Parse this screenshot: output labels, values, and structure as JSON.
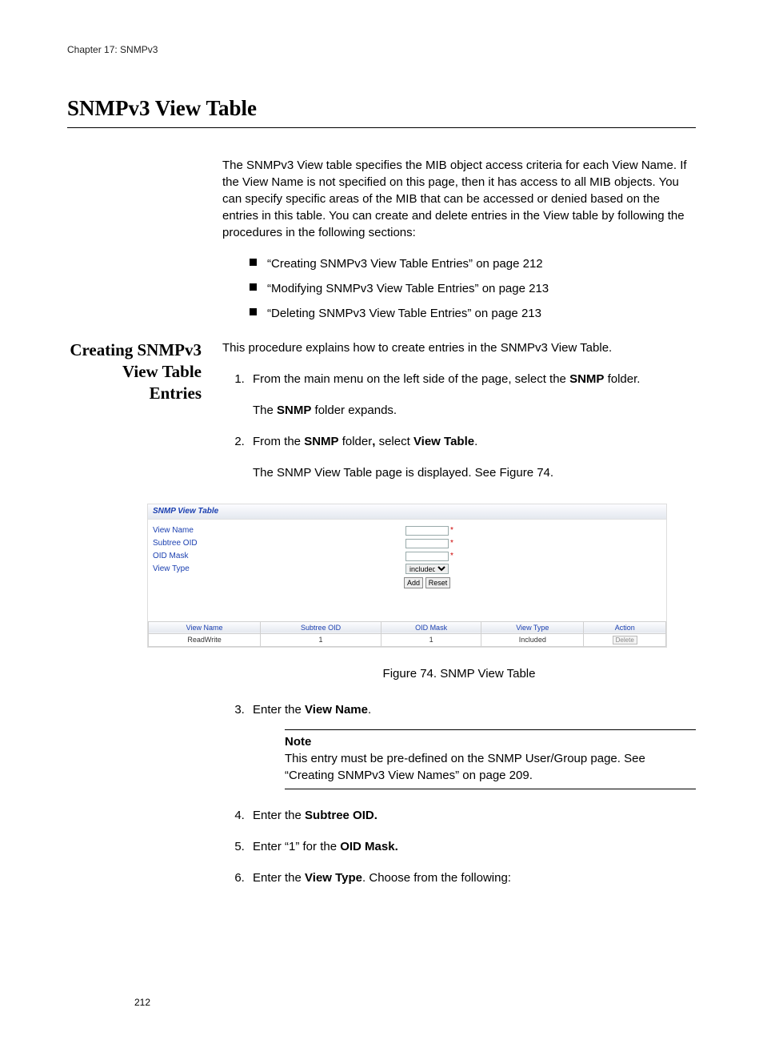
{
  "chapterLine": "Chapter 17: SNMPv3",
  "h1": "SNMPv3 View Table",
  "introPara": "The SNMPv3 View table specifies the MIB object access criteria for each View Name. If the View Name is not specified on this page, then it has access to all MIB objects. You can specify specific areas of the MIB that can be accessed or denied based on the entries in this table. You can create and delete entries in the View table by following the procedures in the following sections:",
  "bullets": [
    "“Creating SNMPv3 View Table Entries” on page 212",
    "“Modifying SNMPv3 View Table Entries” on page 213",
    "“Deleting SNMPv3 View Table Entries” on page 213"
  ],
  "sideHeading": "Creating SNMPv3 View Table Entries",
  "procIntro": "This procedure explains how to create entries in the SNMPv3 View Table.",
  "step1_a": "From the main menu on the left side of the page, select the ",
  "step1_b_bold": "SNMP",
  "step1_c": " folder.",
  "step1_sub_a": "The ",
  "step1_sub_b_bold": "SNMP",
  "step1_sub_c": " folder expands.",
  "step2_a": "From the ",
  "step2_b_bold": "SNMP",
  "step2_c": " folder",
  "step2_c2_bold": ",",
  "step2_d": " select ",
  "step2_e_bold": "View Table",
  "step2_f": ".",
  "step2_sub": "The SNMP View Table page is displayed. See Figure 74.",
  "figCaption": "Figure 74. SNMP View Table",
  "step3_a": "Enter the ",
  "step3_b_bold": "View Name",
  "step3_c": ".",
  "note_label": "Note",
  "note_body": "This entry must be pre-defined on the SNMP User/Group page. See “Creating SNMPv3 View Names” on page 209.",
  "step4_a": "Enter the ",
  "step4_b_bold": "Subtree OID.",
  "step5_a": "Enter “1” for the ",
  "step5_b_bold": "OID Mask.",
  "step6_a": "Enter the ",
  "step6_b_bold": "View Type",
  "step6_c": ". Choose from the following:",
  "pageNumber": "212",
  "snmp": {
    "title": "SNMP View Table",
    "labels": {
      "viewName": "View Name",
      "subtreeOID": "Subtree OID",
      "oidMask": "OID Mask",
      "viewType": "View Type"
    },
    "selectValue": "included",
    "buttons": {
      "add": "Add",
      "reset": "Reset",
      "delete": "Delete"
    },
    "headers": {
      "viewName": "View Name",
      "subtreeOID": "Subtree OID",
      "oidMask": "OID Mask",
      "viewType": "View Type",
      "action": "Action"
    },
    "row": {
      "viewName": "ReadWrite",
      "subtreeOID": "1",
      "oidMask": "1",
      "viewType": "Included"
    }
  }
}
